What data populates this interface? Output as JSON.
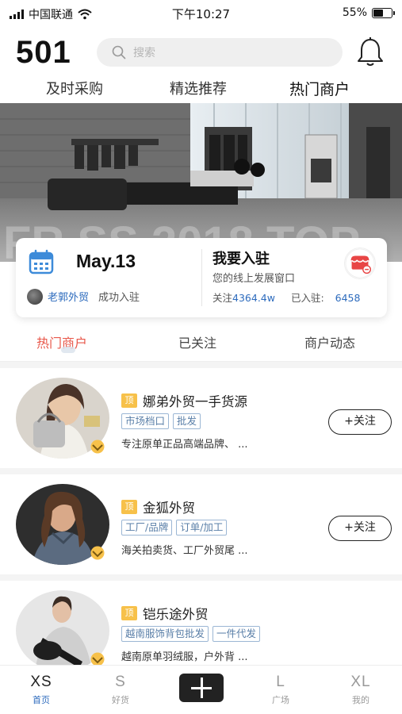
{
  "status_bar": {
    "carrier": "中国联通",
    "time": "下午10:27",
    "battery": "55%",
    "battery_level": 0.55
  },
  "header": {
    "brand": "501",
    "search_placeholder": "搜索"
  },
  "top_tabs": [
    {
      "label": "及时采购"
    },
    {
      "label": "精选推荐"
    },
    {
      "label": "热门商户",
      "active": true
    }
  ],
  "banner": {
    "overlay_text": "FR  SS 2018 TOP"
  },
  "promo_card": {
    "date": "May.13",
    "merchant": "老郭外贸",
    "joined_text": "成功入驻",
    "title": "我要入驻",
    "subtitle": "您的线上发展窗口",
    "follow_label": "关注",
    "follow_count": "4364.4w",
    "joined_label": "已入驻:",
    "joined_count": "6458"
  },
  "sub_tabs": [
    {
      "label": "热门商户",
      "active": true
    },
    {
      "label": "已关注"
    },
    {
      "label": "商户动态"
    }
  ],
  "merchants": [
    {
      "badge": "顶",
      "name": "娜弟外贸一手货源",
      "tags": [
        "市场档口",
        "批发"
      ],
      "desc": "专注原单正品高端品牌、 ...",
      "follow": "+关注"
    },
    {
      "badge": "顶",
      "name": "金狐外贸",
      "tags": [
        "工厂/品牌",
        "订单/加工"
      ],
      "desc": "海关拍卖货、工厂外贸尾 ...",
      "follow": "+关注"
    },
    {
      "badge": "顶",
      "name": "铠乐途外贸",
      "tags": [
        "越南服饰背包批发",
        "一件代发"
      ],
      "desc": "越南原单羽绒服，户外背 ..."
    }
  ],
  "bottom_nav": [
    {
      "big": "XS",
      "small": "首页",
      "active": true
    },
    {
      "big": "S",
      "small": "好货"
    },
    {
      "big": "L",
      "small": "广场"
    },
    {
      "big": "XL",
      "small": "我的"
    }
  ],
  "colors": {
    "accent_red": "#e8574a",
    "link_blue": "#2d6bbd",
    "badge_yellow": "#f7c14a"
  }
}
